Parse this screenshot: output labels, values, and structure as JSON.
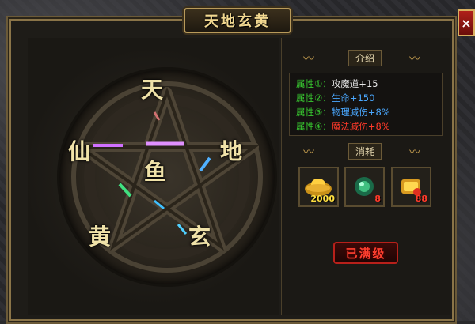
{
  "window": {
    "title": "天地玄黄",
    "close_label": "×"
  },
  "wheel": {
    "glyphs": {
      "top": "天",
      "left": "仙",
      "right": "地",
      "center": "鱼",
      "bottom_left": "黄",
      "bottom_right": "玄"
    }
  },
  "intro": {
    "header": "介绍",
    "attributes": [
      {
        "label": "属性①：",
        "value": "攻魔道+15",
        "color": "#e8e8e8"
      },
      {
        "label": "属性②：",
        "value": "生命+150",
        "color": "#4aa8ff"
      },
      {
        "label": "属性③：",
        "value": "物理减伤+8%",
        "color": "#4aa8ff"
      },
      {
        "label": "属性④：",
        "value": "魔法减伤+8%",
        "color": "#ff3a2a"
      }
    ]
  },
  "cost": {
    "header": "消耗",
    "items": [
      {
        "icon": "gold-ingot-icon",
        "count": "2000",
        "count_color": "#ffe040"
      },
      {
        "icon": "jade-orb-icon",
        "count": "8",
        "count_color": "#ff3a2a"
      },
      {
        "icon": "gold-treasure-icon",
        "count": "88",
        "count_color": "#ff3a2a"
      }
    ]
  },
  "action": {
    "max_label": "已满级"
  }
}
